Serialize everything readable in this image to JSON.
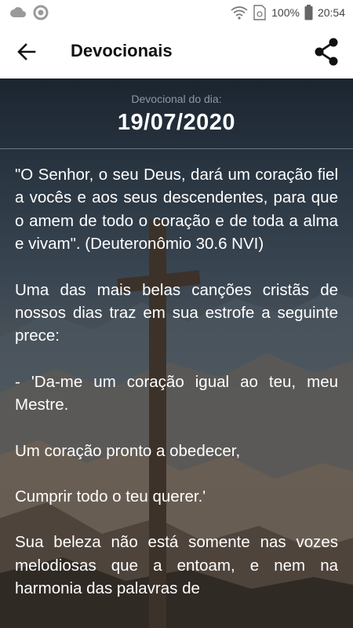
{
  "status_bar": {
    "battery": "100%",
    "time": "20:54",
    "icons": [
      "cloud-icon",
      "circle-icon",
      "wifi-icon",
      "sim-icon",
      "battery-icon"
    ]
  },
  "app_bar": {
    "title": "Devocionais",
    "back_icon": "arrow-left-icon",
    "share_icon": "share-icon"
  },
  "devotional": {
    "label": "Devocional do dia:",
    "date": "19/07/2020",
    "paragraphs": [
      "\"O Senhor, o seu Deus, dará um coração fiel a vocês e aos seus descendentes, para que o amem de todo o coração e de toda a alma e vivam\". (Deuteronômio 30.6 NVI)",
      "Uma das mais belas canções cristãs de nossos dias traz em sua estrofe a seguinte prece:",
      "- 'Da-me um coração igual ao teu, meu Mestre.",
      "Um coração pronto a obedecer,",
      "Cumprir todo o teu querer.'",
      "Sua beleza não está somente nas vozes melodiosas que a entoam, e nem na harmonia das palavras de"
    ]
  },
  "colors": {
    "app_bar_bg": "#ffffff",
    "text": "#ffffff",
    "label": "#8e98a3"
  }
}
